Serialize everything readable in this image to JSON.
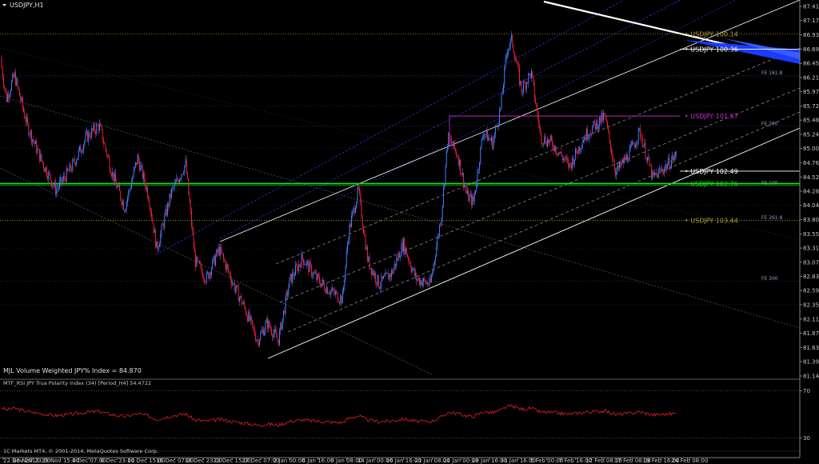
{
  "window": {
    "title": "USDJPY,H1",
    "subwindow_title": "MTF_RSI JPY Trua Polarity Index (34) [Period_H4] 54.4722",
    "index_label": "MJL Volume Weighted JPY% Index = 84.870",
    "copyright": "1C Markets MT4, © 2001-2014, MetaQuotes Software Corp."
  },
  "colors": {
    "background": "#000000",
    "bull": "#3f7fff",
    "bear": "#e8203c",
    "channel": "#ffffff",
    "channel_blue": "#2430c8",
    "hline_gold": "#b8a030",
    "hline_green": "#19e019",
    "hline_magenta": "#d030d0",
    "grid": "#1e4b78",
    "rsi": "#e02020"
  },
  "chart_data": {
    "type": "candlestick",
    "symbol": "USDJPY",
    "timeframe": "H1",
    "ylim": [
      81.148,
      87.418
    ],
    "y_ticks": [
      "87.418",
      "87.178",
      "86.938",
      "86.693",
      "86.453",
      "86.213",
      "85.973",
      "85.728",
      "85.488",
      "85.248",
      "85.008",
      "84.768",
      "84.523",
      "84.283",
      "84.043",
      "83.803",
      "83.558",
      "83.318",
      "83.078",
      "82.838",
      "82.598",
      "82.358",
      "82.113",
      "81.873",
      "81.633",
      "81.393",
      "81.148"
    ],
    "x_ticks": [
      "22 Nov 2013",
      "26 Nov 23:00",
      "29 Nov 15:00",
      "4 Dec 07:00",
      "6 Dec 23:00",
      "11 Dec 15:00",
      "16 Dec 07:00",
      "18 Dec 23:00",
      "23 Dec 15:00",
      "27 Dec 07:00",
      "2 Jan 00:00",
      "6 Jan 16:00",
      "9 Jan 08:00",
      "14 Jan 00:00",
      "16 Jan 16:00",
      "21 Jan 08:00",
      "24 Jan 00:00",
      "28 Jan 16:00",
      "31 Jan 16:00",
      "5 Feb 00:00",
      "7 Feb 16:00",
      "12 Feb 08:00",
      "17 Feb 08:00",
      "19 Feb 16:00",
      "24 Feb 08:00"
    ],
    "path_keypoints": [
      [
        0,
        86.55
      ],
      [
        8,
        85.85
      ],
      [
        18,
        86.25
      ],
      [
        34,
        85.4
      ],
      [
        52,
        84.8
      ],
      [
        70,
        84.3
      ],
      [
        90,
        84.7
      ],
      [
        108,
        85.2
      ],
      [
        124,
        85.4
      ],
      [
        140,
        84.6
      ],
      [
        156,
        84.0
      ],
      [
        172,
        84.85
      ],
      [
        186,
        84.2
      ],
      [
        196,
        83.3
      ],
      [
        214,
        84.25
      ],
      [
        232,
        84.75
      ],
      [
        244,
        83.1
      ],
      [
        258,
        82.8
      ],
      [
        274,
        83.3
      ],
      [
        292,
        82.7
      ],
      [
        306,
        82.3
      ],
      [
        322,
        81.75
      ],
      [
        334,
        82.05
      ],
      [
        348,
        81.75
      ],
      [
        362,
        82.75
      ],
      [
        378,
        83.15
      ],
      [
        396,
        82.8
      ],
      [
        412,
        82.6
      ],
      [
        428,
        82.45
      ],
      [
        436,
        83.6
      ],
      [
        448,
        84.3
      ],
      [
        460,
        83.1
      ],
      [
        474,
        82.7
      ],
      [
        490,
        82.9
      ],
      [
        504,
        83.4
      ],
      [
        520,
        82.8
      ],
      [
        538,
        82.7
      ],
      [
        552,
        83.9
      ],
      [
        560,
        85.2
      ],
      [
        572,
        84.9
      ],
      [
        584,
        84.2
      ],
      [
        592,
        84.1
      ],
      [
        604,
        85.3
      ],
      [
        616,
        85.1
      ],
      [
        626,
        85.7
      ],
      [
        634,
        86.7
      ],
      [
        640,
        86.85
      ],
      [
        652,
        86.0
      ],
      [
        664,
        86.3
      ],
      [
        676,
        85.2
      ],
      [
        690,
        85.1
      ],
      [
        712,
        84.7
      ],
      [
        730,
        85.2
      ],
      [
        744,
        85.4
      ],
      [
        756,
        85.55
      ],
      [
        770,
        84.6
      ],
      [
        786,
        84.9
      ],
      [
        800,
        85.3
      ],
      [
        816,
        84.5
      ],
      [
        832,
        84.7
      ],
      [
        846,
        84.9
      ]
    ],
    "horizontal_levels": [
      {
        "label": "USDJPY 100.14",
        "value": 86.953,
        "kind": "gold"
      },
      {
        "label": "USDJPY 100.36",
        "value": 86.691,
        "kind": "white"
      },
      {
        "label": "USDJPY 101.57",
        "value": 85.558,
        "kind": "magenta"
      },
      {
        "label": "USDJPY 102.49",
        "value": 84.623,
        "kind": "white"
      },
      {
        "label": "USDJPY 102.76",
        "value": 84.413,
        "kind": "green"
      },
      {
        "label": "USDJPY 103.44",
        "value": 83.785,
        "kind": "gold"
      }
    ],
    "fib_levels": [
      {
        "label": "FE 200",
        "value": 85.385
      },
      {
        "label": "FE 161.8",
        "value": 86.243
      },
      {
        "label": "FE 100",
        "value": 84.375
      },
      {
        "label": "FE 261.8",
        "value": 83.785
      },
      {
        "label": "FE 300",
        "value": 82.759
      }
    ],
    "subwindow": {
      "indicator": "MTF_RSI JPY Trua Polarity Index",
      "period": 34,
      "value": 54.4722,
      "levels": [
        70,
        30
      ],
      "ylim": [
        20,
        80
      ]
    }
  }
}
